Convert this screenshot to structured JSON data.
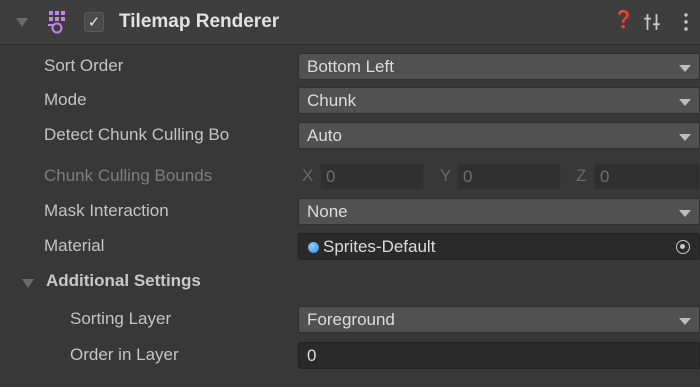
{
  "component": {
    "icon": "tilemap-renderer-icon",
    "enabled_check": "✓",
    "title": "Tilemap Renderer",
    "buttons": {
      "help": "help-icon",
      "presets": "presets-icon",
      "menu": "kebab-menu-icon"
    }
  },
  "properties": {
    "sort_order": {
      "label": "Sort Order",
      "value": "Bottom Left"
    },
    "mode": {
      "label": "Mode",
      "value": "Chunk"
    },
    "detect_chunk_culling": {
      "label": "Detect Chunk Culling Bo",
      "value": "Auto"
    },
    "chunk_culling_bounds": {
      "label": "Chunk Culling Bounds",
      "x_label": "X",
      "x": "0",
      "y_label": "Y",
      "y": "0",
      "z_label": "Z",
      "z": "0"
    },
    "mask_interaction": {
      "label": "Mask Interaction",
      "value": "None"
    },
    "material": {
      "label": "Material",
      "value": "Sprites-Default",
      "icon": "material-sphere-icon"
    }
  },
  "additional_settings": {
    "title": "Additional Settings",
    "sorting_layer": {
      "label": "Sorting Layer",
      "value": "Foreground"
    },
    "order_in_layer": {
      "label": "Order in Layer",
      "value": "0"
    }
  },
  "colors": {
    "background": "#383838",
    "header": "#3e3e3e",
    "field": "#515151",
    "object_field": "#2a2a2a",
    "material_dot": "#2f86d8"
  }
}
